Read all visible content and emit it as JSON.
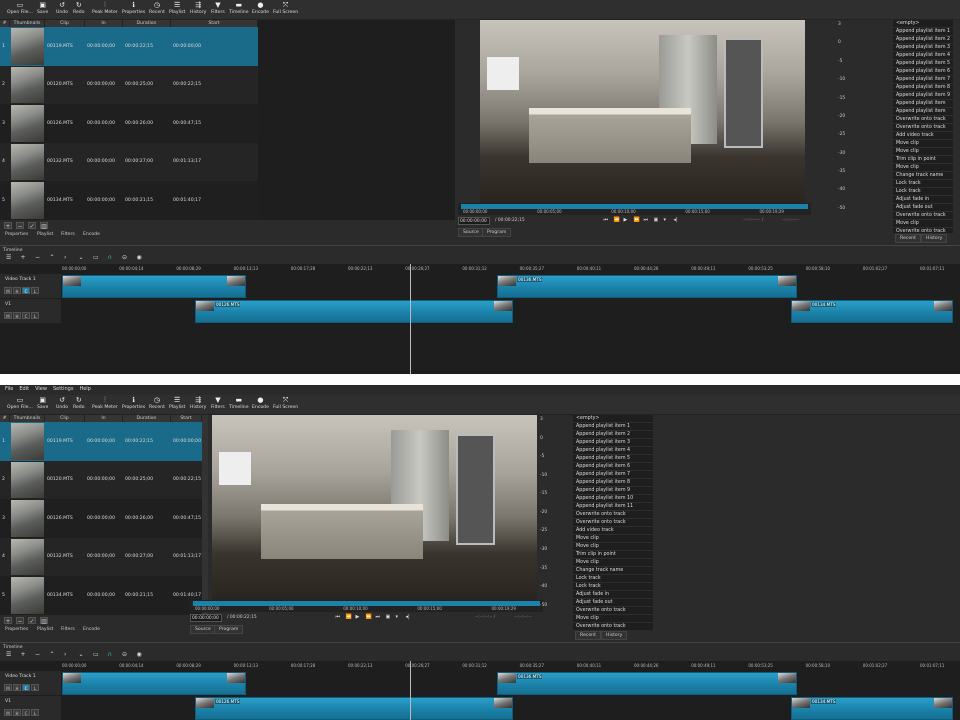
{
  "toolbar": [
    {
      "label": "Open File...",
      "icon": "folder-open-icon",
      "glyph": "▭"
    },
    {
      "label": "Save",
      "icon": "save-icon",
      "glyph": "▣"
    },
    {
      "label": "Undo",
      "icon": "undo-icon",
      "glyph": "↺"
    },
    {
      "label": "Redo",
      "icon": "redo-icon",
      "glyph": "↻"
    },
    {
      "label": "Peak Meter",
      "icon": "peak-meter-icon",
      "glyph": "⫶"
    },
    {
      "label": "Properties",
      "icon": "info-icon",
      "glyph": "ℹ"
    },
    {
      "label": "Recent",
      "icon": "clock-icon",
      "glyph": "◷"
    },
    {
      "label": "Playlist",
      "icon": "list-icon",
      "glyph": "☰"
    },
    {
      "label": "History",
      "icon": "history-icon",
      "glyph": "⇶"
    },
    {
      "label": "Filters",
      "icon": "filter-icon",
      "glyph": "▼"
    },
    {
      "label": "Timeline",
      "icon": "timeline-icon",
      "glyph": "▬"
    },
    {
      "label": "Encode",
      "icon": "encode-icon",
      "glyph": "●"
    },
    {
      "label": "Full Screen",
      "icon": "fullscreen-icon",
      "glyph": "⤧"
    }
  ],
  "menu": [
    "File",
    "Edit",
    "View",
    "Settings",
    "Help"
  ],
  "playlist": {
    "columns": [
      "#",
      "Thumbnails",
      "Clip",
      "In",
      "Duration",
      "Start"
    ],
    "rows": [
      [
        "1",
        "00119.MTS",
        "00:00:00;00",
        "00:00:22;15",
        "00:00:00;00"
      ],
      [
        "2",
        "00120.MTS",
        "00:00:00;00",
        "00:00:25;00",
        "00:00:22;15"
      ],
      [
        "3",
        "00126.MTS",
        "00:00:00;00",
        "00:00:26;00",
        "00:00:47;15"
      ],
      [
        "4",
        "00132.MTS",
        "00:00:00;00",
        "00:00:27;00",
        "00:01:13;17"
      ],
      [
        "5",
        "00134.MTS",
        "00:00:00;00",
        "00:00:21;15",
        "00:01:40;17"
      ]
    ],
    "selected_row": 0,
    "buttons": [
      {
        "name": "add",
        "glyph": "+"
      },
      {
        "name": "remove",
        "glyph": "−"
      },
      {
        "name": "update",
        "glyph": "✓"
      },
      {
        "name": "delete",
        "glyph": "▥"
      }
    ],
    "tabs": [
      "Properties",
      "Playlist",
      "Filters",
      "Encode"
    ]
  },
  "player": {
    "scrub_ticks": [
      "00:00:00;00",
      "00:00:05;00",
      "00:00:10;00",
      "00:00:15;00",
      "00:00:19;29"
    ],
    "position": "00:00:00;00",
    "duration": "/ 00:00:22;15",
    "transport": [
      "⏮",
      "⏪",
      "▶",
      "⏩",
      "⏭",
      "▣",
      "▾",
      "◂|"
    ],
    "in_point": "--:--:--:-- /",
    "out_point": "--:--:--:--",
    "tabs": [
      "Source",
      "Program"
    ]
  },
  "meter": [
    "3",
    "0",
    "-5",
    "-10",
    "-15",
    "-20",
    "-25",
    "-30",
    "-35",
    "-40",
    "-50"
  ],
  "history": {
    "items": [
      "<empty>",
      "Append playlist item 1",
      "Append playlist item 2",
      "Append playlist item 3",
      "Append playlist item 4",
      "Append playlist item 5",
      "Append playlist item 6",
      "Append playlist item 7",
      "Append playlist item 8",
      "Append playlist item 9",
      "Append playlist item 10",
      "Append playlist item 11",
      "Overwrite onto track",
      "Overwrite onto track",
      "Add video track",
      "Move clip",
      "Move clip",
      "Trim clip in point",
      "Move clip",
      "Change track name",
      "Lock track",
      "Lock track",
      "Adjust fade in",
      "Adjust fade out",
      "Overwrite onto track",
      "Move clip",
      "Overwrite onto track"
    ],
    "tabs": [
      "Recent",
      "History"
    ]
  },
  "timeline": {
    "title": "Timeline",
    "tools": [
      "☰",
      "+",
      "−",
      "⌃",
      "›",
      "⌄",
      "▭",
      "∩",
      "⊝",
      "◉"
    ],
    "ticks": [
      "00:00:00;00",
      "00:00:04;14",
      "00:00:08;29",
      "00:00:13;13",
      "00:00:17;28",
      "00:00:22;13",
      "00:00:26;27",
      "00:00:31;12",
      "00:00:35;27",
      "00:00:40;11",
      "00:00:44;26",
      "00:00:49;11",
      "00:00:53;25",
      "00:00:58;10",
      "00:01:02;27",
      "00:01:07;11"
    ],
    "tracks": [
      {
        "name": "Video Track 1",
        "buttons": [
          "M",
          "H",
          "C",
          "L"
        ],
        "active": "C",
        "clips": [
          "",
          "00136.MTS"
        ]
      },
      {
        "name": "V1",
        "buttons": [
          "M",
          "H",
          "C",
          "L"
        ],
        "active": "",
        "clips": [
          "00126.MTS",
          "00134.MTS"
        ]
      }
    ]
  },
  "colors": {
    "accent": "#1b82aa",
    "selection": "#1a6a8a",
    "background": "#2b2b2b"
  }
}
